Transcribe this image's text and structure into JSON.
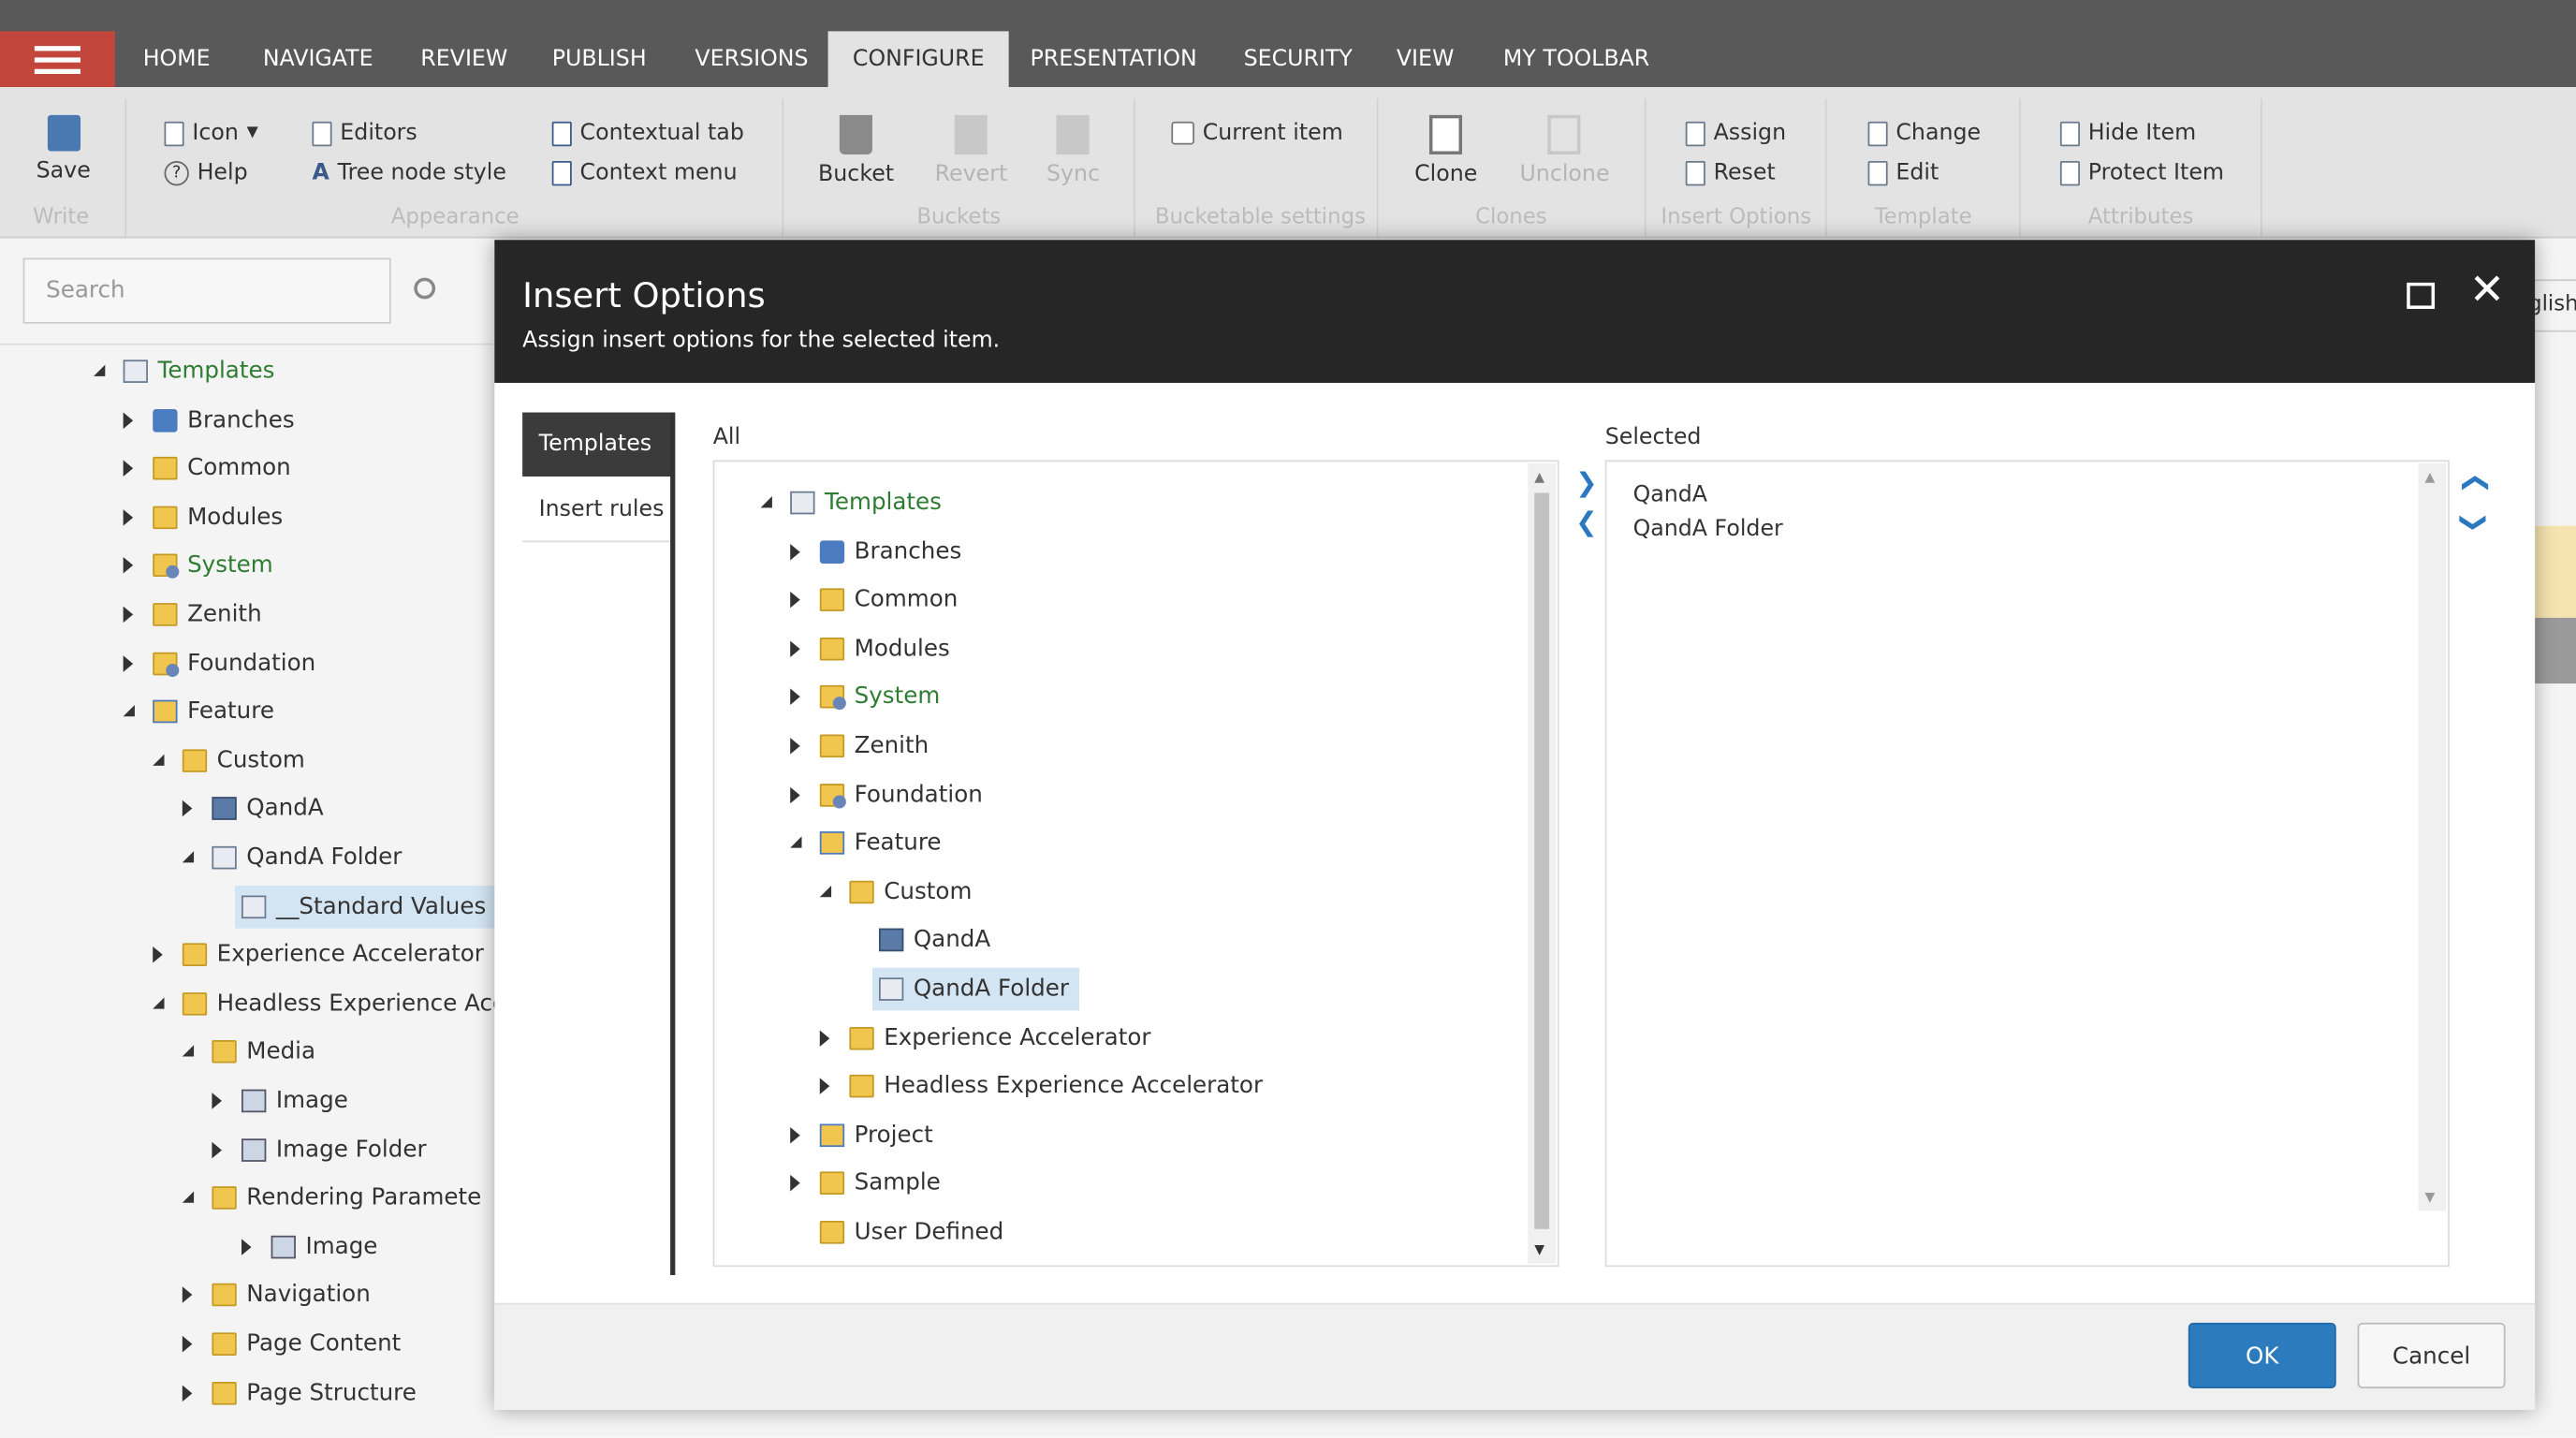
{
  "nav": {
    "menu_icon": "hamburger-icon",
    "tabs": [
      "HOME",
      "NAVIGATE",
      "REVIEW",
      "PUBLISH",
      "VERSIONS",
      "CONFIGURE",
      "PRESENTATION",
      "SECURITY",
      "VIEW",
      "MY TOOLBAR"
    ],
    "active_tab": "CONFIGURE"
  },
  "ribbon": {
    "save": "Save",
    "write": "Write",
    "icon": "Icon",
    "help": "Help",
    "editors": "Editors",
    "tree_node_style": "Tree node style",
    "contextual_tab": "Contextual tab",
    "context_menu": "Context menu",
    "appearance": "Appearance",
    "bucket": "Bucket",
    "revert": "Revert",
    "sync": "Sync",
    "buckets": "Buckets",
    "current_item": "Current item",
    "bucketable_settings": "Bucketable settings",
    "clone": "Clone",
    "unclone": "Unclone",
    "clones": "Clones",
    "assign": "Assign",
    "reset": "Reset",
    "insert_options": "Insert Options",
    "change": "Change",
    "edit": "Edit",
    "template": "Template",
    "hide_item": "Hide Item",
    "protect_item": "Protect Item",
    "attributes": "Attributes"
  },
  "sidebar": {
    "search_placeholder": "Search",
    "tree": [
      {
        "label": "Templates",
        "level": 0,
        "state": "open",
        "icon": "template",
        "green": true
      },
      {
        "label": "Branches",
        "level": 1,
        "state": "closed",
        "icon": "branch"
      },
      {
        "label": "Common",
        "level": 1,
        "state": "closed",
        "icon": "folder"
      },
      {
        "label": "Modules",
        "level": 1,
        "state": "closed",
        "icon": "folder"
      },
      {
        "label": "System",
        "level": 1,
        "state": "closed",
        "icon": "system",
        "green": true
      },
      {
        "label": "Zenith",
        "level": 1,
        "state": "closed",
        "icon": "folder"
      },
      {
        "label": "Foundation",
        "level": 1,
        "state": "closed",
        "icon": "system"
      },
      {
        "label": "Feature",
        "level": 1,
        "state": "open",
        "icon": "project"
      },
      {
        "label": "Custom",
        "level": 2,
        "state": "open",
        "icon": "folder"
      },
      {
        "label": "QandA",
        "level": 3,
        "state": "closed",
        "icon": "qanda"
      },
      {
        "label": "QandA Folder",
        "level": 3,
        "state": "open",
        "icon": "template"
      },
      {
        "label": "__Standard Values",
        "level": 4,
        "state": "leaf",
        "icon": "template",
        "selected": true
      },
      {
        "label": "Experience Accelerator",
        "level": 2,
        "state": "closed",
        "icon": "folder"
      },
      {
        "label": "Headless Experience Accel",
        "level": 2,
        "state": "open",
        "icon": "folder"
      },
      {
        "label": "Media",
        "level": 3,
        "state": "open",
        "icon": "folder"
      },
      {
        "label": "Image",
        "level": 4,
        "state": "closed",
        "icon": "media"
      },
      {
        "label": "Image Folder",
        "level": 4,
        "state": "closed",
        "icon": "media"
      },
      {
        "label": "Rendering Paramete",
        "level": 3,
        "state": "open",
        "icon": "folder"
      },
      {
        "label": "Image",
        "level": 5,
        "state": "closed",
        "icon": "media"
      },
      {
        "label": "Navigation",
        "level": 3,
        "state": "closed",
        "icon": "folder"
      },
      {
        "label": "Page Content",
        "level": 3,
        "state": "closed",
        "icon": "folder"
      },
      {
        "label": "Page Structure",
        "level": 3,
        "state": "closed",
        "icon": "folder"
      }
    ]
  },
  "background": {
    "language_fragment": "glish"
  },
  "dialog": {
    "title": "Insert Options",
    "subtitle": "Assign insert options for the selected item.",
    "side_tabs": [
      "Templates",
      "Insert rules"
    ],
    "all_label": "All",
    "selected_label": "Selected",
    "all_tree": [
      {
        "label": "Templates",
        "level": 0,
        "state": "open",
        "icon": "template",
        "green": true
      },
      {
        "label": "Branches",
        "level": 1,
        "state": "closed",
        "icon": "branch"
      },
      {
        "label": "Common",
        "level": 1,
        "state": "closed",
        "icon": "folder"
      },
      {
        "label": "Modules",
        "level": 1,
        "state": "closed",
        "icon": "folder"
      },
      {
        "label": "System",
        "level": 1,
        "state": "closed",
        "icon": "system",
        "green": true
      },
      {
        "label": "Zenith",
        "level": 1,
        "state": "closed",
        "icon": "folder"
      },
      {
        "label": "Foundation",
        "level": 1,
        "state": "closed",
        "icon": "system"
      },
      {
        "label": "Feature",
        "level": 1,
        "state": "open",
        "icon": "project"
      },
      {
        "label": "Custom",
        "level": 2,
        "state": "open",
        "icon": "folder"
      },
      {
        "label": "QandA",
        "level": 3,
        "state": "leaf",
        "icon": "qanda"
      },
      {
        "label": "QandA Folder",
        "level": 3,
        "state": "leaf",
        "icon": "template",
        "selected": true
      },
      {
        "label": "Experience Accelerator",
        "level": 2,
        "state": "closed",
        "icon": "folder"
      },
      {
        "label": "Headless Experience Accelerator",
        "level": 2,
        "state": "closed",
        "icon": "folder"
      },
      {
        "label": "Project",
        "level": 1,
        "state": "closed",
        "icon": "project"
      },
      {
        "label": "Sample",
        "level": 1,
        "state": "closed",
        "icon": "folder"
      },
      {
        "label": "User Defined",
        "level": 1,
        "state": "leaf",
        "icon": "folder"
      }
    ],
    "selected_items": [
      "QandA",
      "QandA Folder"
    ],
    "ok": "OK",
    "cancel": "Cancel",
    "colors": {
      "header": "#262626",
      "ok": "#2b7bbd",
      "accent": "#2b78c0"
    }
  }
}
